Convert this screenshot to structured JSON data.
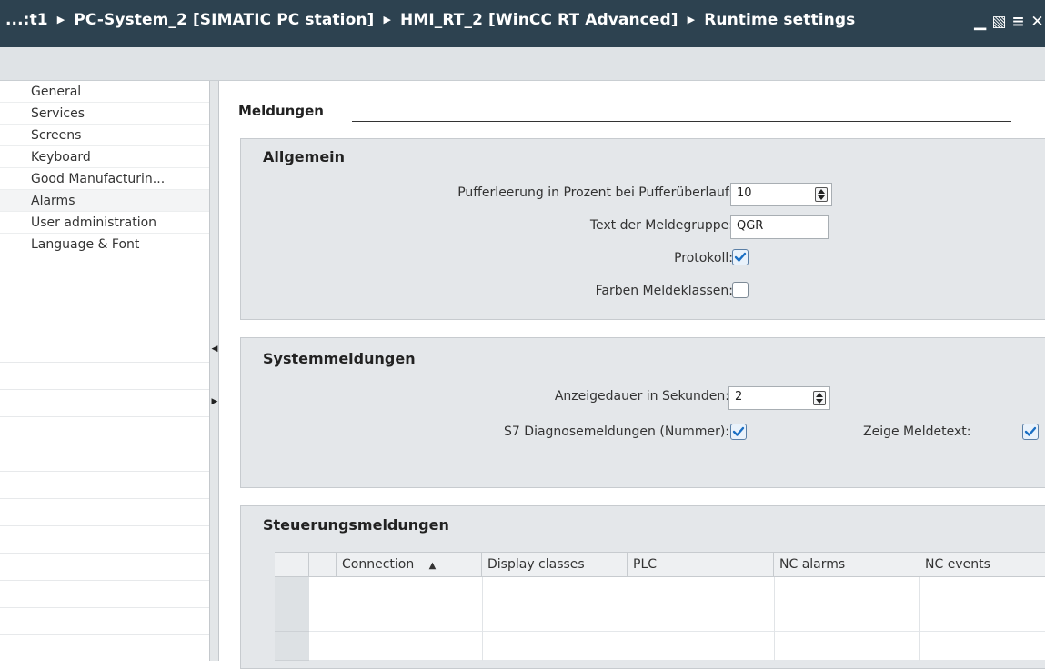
{
  "title_bar": {
    "crumbs": [
      "...:t1",
      "PC-System_2 [SIMATIC PC station]",
      "HMI_RT_2 [WinCC RT Advanced]",
      "Runtime settings"
    ],
    "window_buttons": {
      "minimize": "▁",
      "restore": "▧",
      "menu": "≡",
      "close": "✕"
    }
  },
  "sidebar": {
    "items": [
      {
        "label": "General"
      },
      {
        "label": "Services"
      },
      {
        "label": "Screens"
      },
      {
        "label": "Keyboard"
      },
      {
        "label": "Good Manufacturin..."
      },
      {
        "label": "Alarms",
        "active": true
      },
      {
        "label": "User administration"
      },
      {
        "label": "Language & Font"
      }
    ]
  },
  "main": {
    "section_title": "Meldungen",
    "general": {
      "title": "Allgemein",
      "buffer_label": "Pufferleerung in Prozent bei Pufferüberlauf:",
      "buffer_value": "10",
      "group_text_label": "Text der Meldegruppe:",
      "group_text_value": "QGR",
      "protocol_label": "Protokoll:",
      "protocol_checked": true,
      "colors_label": "Farben Meldeklassen:",
      "colors_checked": false
    },
    "system": {
      "title": "Systemmeldungen",
      "duration_label": "Anzeigedauer in Sekunden:",
      "duration_value": "2",
      "s7_label": "S7 Diagnosemeldungen (Nummer):",
      "s7_checked": true,
      "show_text_label": "Zeige Meldetext:",
      "show_text_checked": true
    },
    "control": {
      "title": "Steuerungsmeldungen",
      "columns": [
        {
          "label": "Connection",
          "sort": "▲"
        },
        {
          "label": "Display classes"
        },
        {
          "label": "PLC"
        },
        {
          "label": "NC alarms"
        },
        {
          "label": "NC events"
        }
      ]
    }
  },
  "colors": {
    "title_bar": "#2d4250",
    "check_blue": "#1a6fc4",
    "panel": "#e4e7ea"
  }
}
